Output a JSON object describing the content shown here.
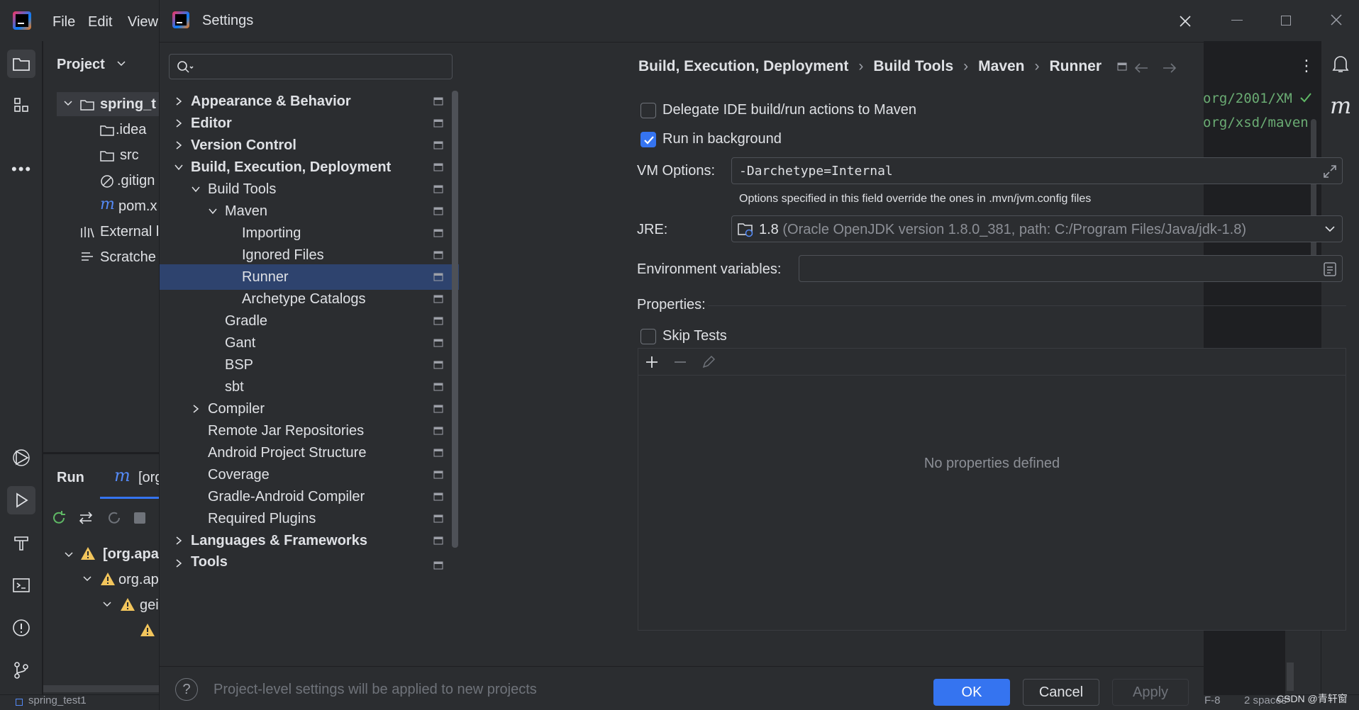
{
  "ide": {
    "menu": {
      "file": "File",
      "edit": "Edit",
      "view": "View"
    },
    "project_header": "Project",
    "tree": {
      "root": "spring_t",
      "idea": ".idea",
      "src": "src",
      "gitignore": ".gitign",
      "pom": "pom.x",
      "external": "External l",
      "scratches": "Scratche"
    },
    "run": {
      "tab_run": "Run",
      "tab_org": "[org",
      "rows": [
        "[org.apa",
        "org.ap",
        "gei"
      ]
    },
    "editor_lines": [
      "org/2001/XM",
      "org/xsd/maven-"
    ],
    "status": {
      "project": "spring_test1",
      "encoding": "F-8",
      "indent": "2 spaces*"
    },
    "watermark": "CSDN @青轩窗"
  },
  "dialog": {
    "title": "Settings",
    "search": {
      "placeholder": ""
    },
    "nav": [
      {
        "label": "Appearance & Behavior"
      },
      {
        "label": "Editor"
      },
      {
        "label": "Version Control"
      },
      {
        "label": "Build, Execution, Deployment"
      },
      {
        "label": "Build Tools"
      },
      {
        "label": "Maven"
      },
      {
        "label": "Importing"
      },
      {
        "label": "Ignored Files"
      },
      {
        "label": "Runner"
      },
      {
        "label": "Archetype Catalogs"
      },
      {
        "label": "Gradle"
      },
      {
        "label": "Gant"
      },
      {
        "label": "BSP"
      },
      {
        "label": "sbt"
      },
      {
        "label": "Compiler"
      },
      {
        "label": "Remote Jar Repositories"
      },
      {
        "label": "Android Project Structure"
      },
      {
        "label": "Coverage"
      },
      {
        "label": "Gradle-Android Compiler"
      },
      {
        "label": "Required Plugins"
      },
      {
        "label": "Languages & Frameworks"
      },
      {
        "label": "Tools"
      }
    ],
    "breadcrumb": [
      "Build, Execution, Deployment",
      "Build Tools",
      "Maven",
      "Runner"
    ],
    "breadcrumb_sep": "›",
    "delegate": {
      "label": "Delegate IDE build/run actions to Maven",
      "checked": false
    },
    "background": {
      "label": "Run in background",
      "checked": true
    },
    "vm_options": {
      "label": "VM Options:",
      "value": "-Darchetype=Internal",
      "hint": "Options specified in this field override the ones in .mvn/jvm.config files"
    },
    "jre": {
      "label": "JRE:",
      "version": "1.8",
      "detail": "(Oracle OpenJDK version 1.8.0_381, path: C:/Program Files/Java/jdk-1.8)"
    },
    "env": {
      "label": "Environment variables:",
      "value": ""
    },
    "properties": {
      "label": "Properties:",
      "empty_text": "No properties defined"
    },
    "skip_tests": {
      "label": "Skip Tests",
      "checked": false
    },
    "footer": {
      "hint": "Project-level settings will be applied to new projects",
      "ok": "OK",
      "cancel": "Cancel",
      "apply": "Apply",
      "help": "?"
    }
  },
  "colors": {
    "accent": "#3574f0",
    "selection": "#2e436e",
    "background": "#2b2d30",
    "warning": "#f2c55c",
    "string_green": "#6aab73"
  }
}
